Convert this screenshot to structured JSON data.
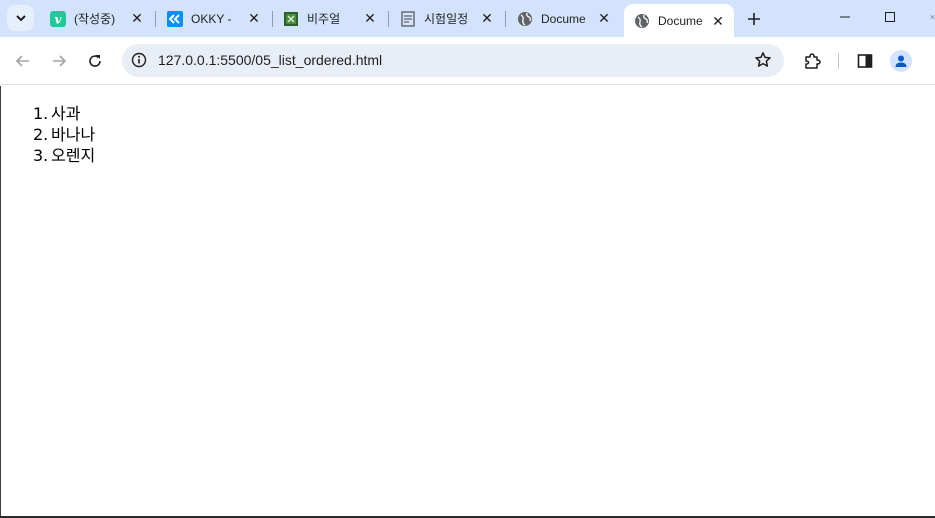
{
  "browser": {
    "tabs": [
      {
        "title": "(작성중)",
        "favicon": "velog-icon",
        "favicon_color": "#20c997",
        "favicon_letter": "v",
        "active": false
      },
      {
        "title": "OKKY -",
        "favicon": "okky-icon",
        "favicon_color": "#0090f9",
        "active": false
      },
      {
        "title": "비주얼",
        "favicon": "vscode-doc-icon",
        "active": false
      },
      {
        "title": "시험일정",
        "favicon": "document-icon",
        "active": false
      },
      {
        "title": "Docume",
        "favicon": "globe-icon",
        "active": false
      },
      {
        "title": "Docume",
        "favicon": "globe-icon",
        "active": true
      }
    ],
    "address": "127.0.0.1:5500/05_list_ordered.html"
  },
  "page": {
    "list": [
      {
        "num": "1.",
        "text": "사과"
      },
      {
        "num": "2.",
        "text": "바나나"
      },
      {
        "num": "3.",
        "text": "오렌지"
      }
    ]
  },
  "colors": {
    "tabstrip": "#d3e3fd",
    "omnibox": "#e9eef6",
    "accent": "#0b57d0"
  }
}
